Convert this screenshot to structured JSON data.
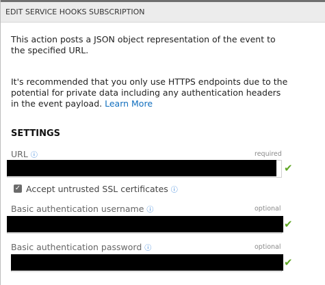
{
  "header": {
    "title": "EDIT SERVICE HOOKS SUBSCRIPTION"
  },
  "description": {
    "para1": "This action posts a JSON object representation of the event to the specified URL.",
    "para2_text": "It's recommended that you only use HTTPS endpoints due to the potential for private data including any authentication headers in the event payload.",
    "learn_more": "Learn More"
  },
  "settings": {
    "heading": "SETTINGS",
    "url": {
      "label": "URL",
      "requirement": "required"
    },
    "accept_ssl": {
      "label": "Accept untrusted SSL certificates",
      "checked": true
    },
    "username": {
      "label": "Basic authentication username",
      "requirement": "optional"
    },
    "password": {
      "label": "Basic authentication password",
      "requirement": "optional"
    }
  },
  "icons": {
    "info": "info-icon",
    "valid": "checkmark-icon",
    "checkbox": "checkbox-checked-icon"
  },
  "colors": {
    "link": "#106ebe",
    "info": "#2a7bd6",
    "valid": "#5fa624"
  }
}
